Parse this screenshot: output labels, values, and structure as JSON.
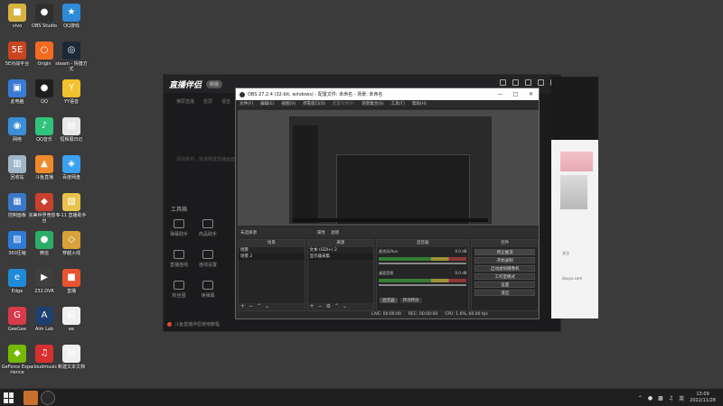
{
  "desktop": {
    "icons": [
      {
        "label": "vivo",
        "color": "#d8b340",
        "glyph": "■"
      },
      {
        "label": "OBS Studio",
        "color": "#2f2f2f",
        "glyph": "●"
      },
      {
        "label": "QQ游戏",
        "color": "#2e8bd8",
        "glyph": "★"
      },
      {
        "label": "5E对战平台",
        "color": "#c9441f",
        "glyph": "5E"
      },
      {
        "label": "Origin",
        "color": "#f26b21",
        "glyph": "○"
      },
      {
        "label": "steam - 快捷方式",
        "color": "#1b2838",
        "glyph": "◎"
      },
      {
        "label": "此电脑",
        "color": "#3a7bd5",
        "glyph": "▣"
      },
      {
        "label": "QQ",
        "color": "#1f1f1f",
        "glyph": "●"
      },
      {
        "label": "YY语音",
        "color": "#f2c12e",
        "glyph": "Y"
      },
      {
        "label": "网络",
        "color": "#3a8fd8",
        "glyph": "◉"
      },
      {
        "label": "QQ音乐",
        "color": "#31c27c",
        "glyph": "♪"
      },
      {
        "label": "恒辉展日记",
        "color": "#e8e8e8",
        "glyph": "▤"
      },
      {
        "label": "回收站",
        "color": "#9fb7c9",
        "glyph": "▥"
      },
      {
        "label": "斗鱼直播",
        "color": "#ef8a2c",
        "glyph": "▲"
      },
      {
        "label": "百度网盘",
        "color": "#3aa0f2",
        "glyph": "◈"
      },
      {
        "label": "控制面板",
        "color": "#3a78c9",
        "glyph": "▦"
      },
      {
        "label": "完美世界竞技平台",
        "color": "#c9402f",
        "glyph": "◆"
      },
      {
        "label": "S-11 直播助手",
        "color": "#e8c24a",
        "glyph": "▧"
      },
      {
        "label": "360压缩",
        "color": "#2f7bd8",
        "glyph": "▨"
      },
      {
        "label": "微信",
        "color": "#2aae67",
        "glyph": "●"
      },
      {
        "label": "穿越火线",
        "color": "#d8a23a",
        "glyph": "◇"
      },
      {
        "label": "Edge",
        "color": "#1f8ad8",
        "glyph": "e"
      },
      {
        "label": "232.DVR",
        "color": "#3f3f3f",
        "glyph": "▶"
      },
      {
        "label": "直播",
        "color": "#e8532f",
        "glyph": "■"
      },
      {
        "label": "GeeGee",
        "color": "#d83a4a",
        "glyph": "G"
      },
      {
        "label": "Aim Lab",
        "color": "#1f3f6f",
        "glyph": "A"
      },
      {
        "label": "ee",
        "color": "#f0f0f0",
        "glyph": "▤"
      },
      {
        "label": "GeForce Experience",
        "color": "#76b900",
        "glyph": "◆"
      },
      {
        "label": "cloudmusic",
        "color": "#d8302f",
        "glyph": "♫"
      },
      {
        "label": "新建文本文档",
        "color": "#f0f0f0",
        "glyph": "▤"
      }
    ]
  },
  "taskbar": {
    "time": "13:09",
    "date": "2022/11/28",
    "tray_text": "英"
  },
  "zb": {
    "logo": "直播伴侣",
    "badge": "新版",
    "tabs": [
      "横屏直播",
      "竖屏",
      "语音"
    ],
    "hint": "添加素材，快速搭建直播画面",
    "tools_title": "工具箱",
    "tools": [
      "弹幕助手",
      "商品助手",
      "直播连线",
      "连线设置",
      "粉丝团",
      "读弹幕"
    ],
    "footer": "斗鱼直播伴侣使用教程",
    "version": "v5.0.9"
  },
  "side": {
    "text1": "douyu.com",
    "text2": "关注"
  },
  "obs": {
    "title": "OBS 27.2.4 (32-bit, windows) - 配置文件: 未命名 - 场景: 未命名",
    "menu": [
      "文件(F)",
      "编辑(E)",
      "视图(V)",
      "停靠窗口(D)",
      "配置文件(P)",
      "场景集合(S)",
      "工具(T)",
      "帮助(H)"
    ],
    "source_bar": {
      "label": "未选择源",
      "props": "属性",
      "filters": "滤镜"
    },
    "scenes": {
      "title": "场景",
      "items": [
        "场景",
        "场景 2"
      ]
    },
    "sources": {
      "title": "来源",
      "items": [
        "文本 (GDI+) 2",
        "显示器采集"
      ]
    },
    "mixer": {
      "title": "混音器",
      "tracks": [
        {
          "name": "麦克风/Aux",
          "db": "0.0 dB"
        },
        {
          "name": "桌面音频",
          "db": "0.0 dB"
        }
      ],
      "tabs": [
        "混音器",
        "转场特效"
      ]
    },
    "controls": {
      "title": "控件",
      "buttons": [
        "停止推流",
        "开始录制",
        "启动虚拟摄像机",
        "工作室模式",
        "设置",
        "退出"
      ]
    },
    "status": {
      "live": "LIVE: 00:00:00",
      "rec": "REC: 00:00:00",
      "cpu": "CPU: 1.6%, 60.00 fps"
    }
  }
}
